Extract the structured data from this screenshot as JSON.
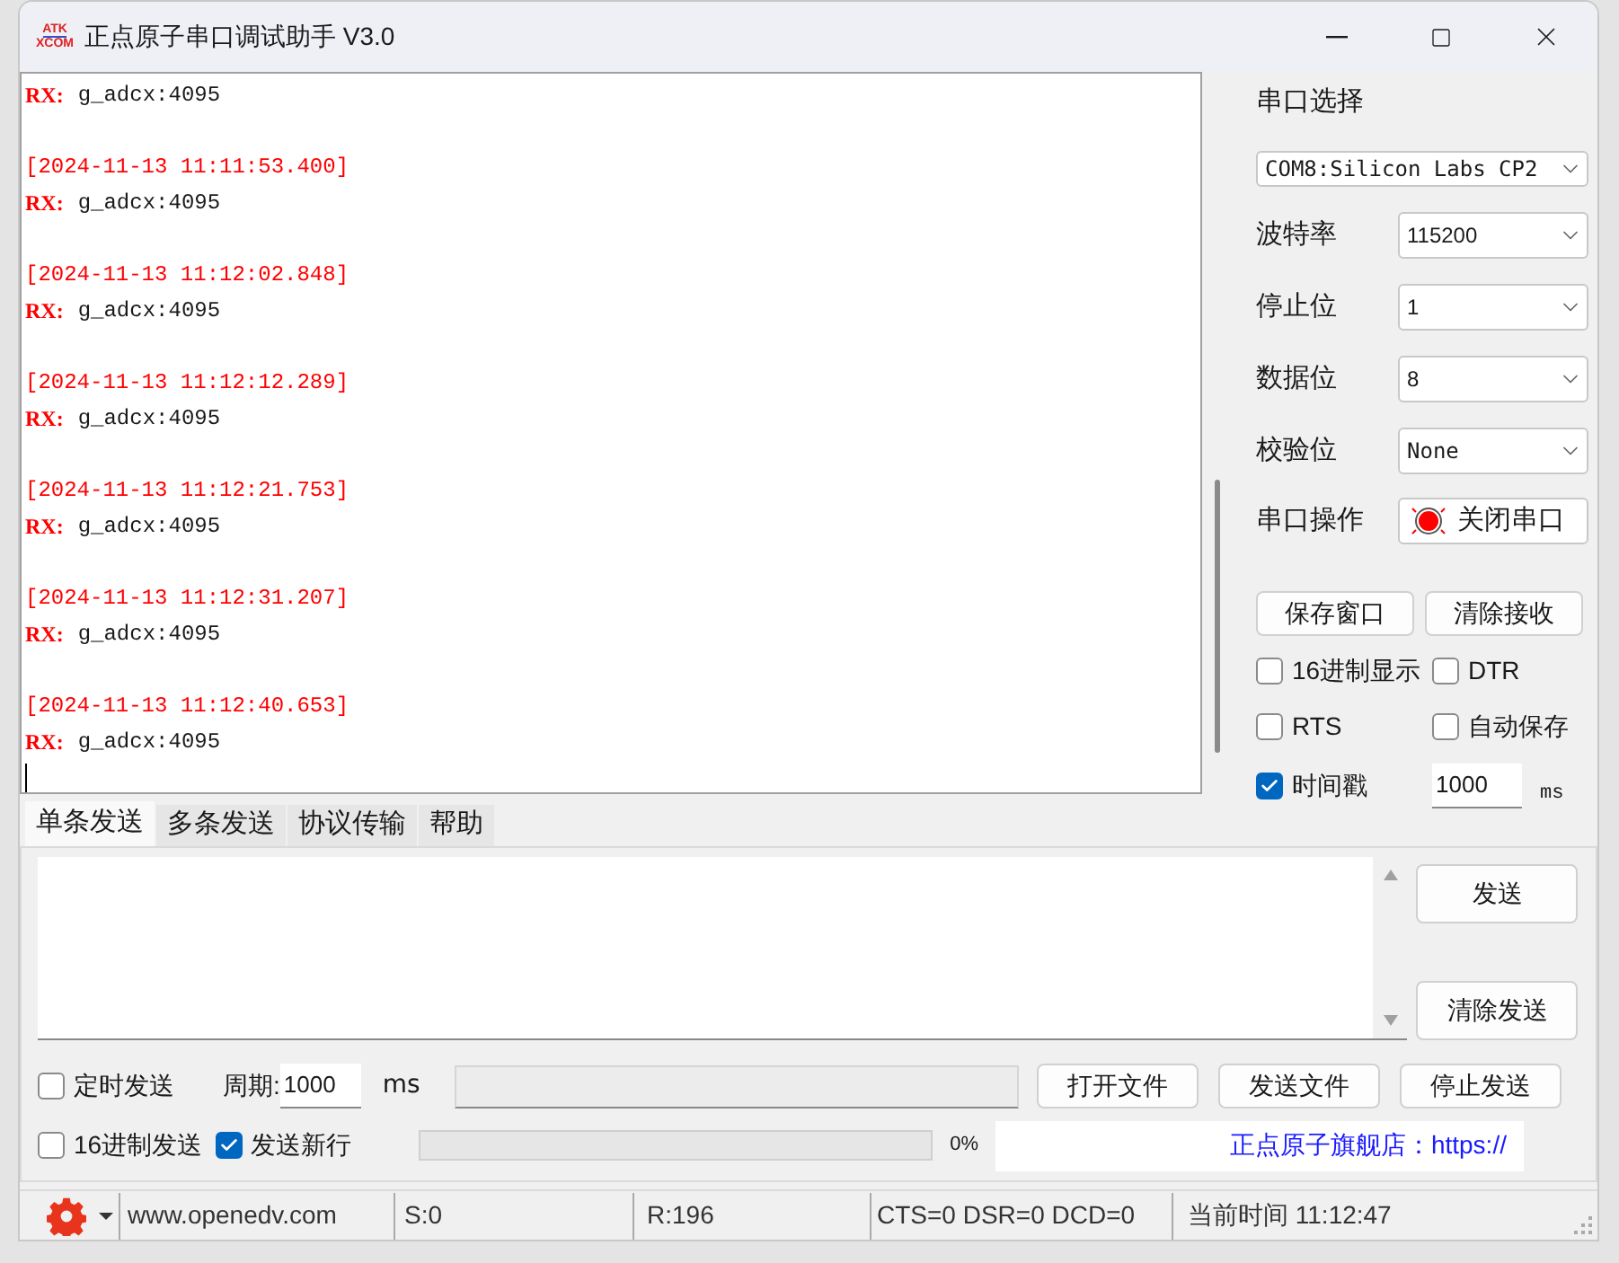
{
  "window": {
    "title": "正点原子串口调试助手 V3.0",
    "logo_top": "ATK",
    "logo_bottom": "XCOM"
  },
  "receive_log": [
    {
      "rx_label": "RX:",
      "data": "g_adcx:4095"
    },
    {
      "timestamp": "[2024-11-13 11:11:53.400]",
      "rx_label": "RX:",
      "data": "g_adcx:4095"
    },
    {
      "timestamp": "[2024-11-13 11:12:02.848]",
      "rx_label": "RX:",
      "data": "g_adcx:4095"
    },
    {
      "timestamp": "[2024-11-13 11:12:12.289]",
      "rx_label": "RX:",
      "data": "g_adcx:4095"
    },
    {
      "timestamp": "[2024-11-13 11:12:21.753]",
      "rx_label": "RX:",
      "data": "g_adcx:4095"
    },
    {
      "timestamp": "[2024-11-13 11:12:31.207]",
      "rx_label": "RX:",
      "data": "g_adcx:4095"
    },
    {
      "timestamp": "[2024-11-13 11:12:40.653]",
      "rx_label": "RX:",
      "data": "g_adcx:4095"
    }
  ],
  "serial": {
    "port_label": "串口选择",
    "port": "COM8:Silicon Labs CP2",
    "fields": [
      {
        "label": "波特率",
        "value": "115200"
      },
      {
        "label": "停止位",
        "value": "1"
      },
      {
        "label": "数据位",
        "value": "8"
      },
      {
        "label": "校验位",
        "value": "None"
      }
    ],
    "operation_label": "串口操作",
    "port_button": "关闭串口",
    "port_open": true
  },
  "receive_buttons": [
    "保存窗口",
    "清除接收"
  ],
  "receive_options": [
    {
      "label": "16进制显示",
      "checked": false
    },
    {
      "label": "DTR",
      "checked": false
    },
    {
      "label": "RTS",
      "checked": false
    },
    {
      "label": "自动保存",
      "checked": false
    },
    {
      "label": "时间戳",
      "checked": true
    }
  ],
  "timestamp_interval": {
    "value": "1000",
    "unit": "ms"
  },
  "send_tabs": [
    {
      "label": "单条发送",
      "selected": true
    },
    {
      "label": "多条发送",
      "selected": false
    },
    {
      "label": "协议传输",
      "selected": false
    },
    {
      "label": "帮助",
      "selected": false
    }
  ],
  "send_buttons": [
    "发送",
    "清除发送"
  ],
  "timed_send": {
    "label": "定时发送",
    "checked": false
  },
  "period": {
    "label": "周期:",
    "value": "1000",
    "unit": "ms"
  },
  "file_buttons": [
    "打开文件",
    "发送文件",
    "停止发送"
  ],
  "send_options": [
    {
      "label": "16进制发送",
      "checked": false
    },
    {
      "label": "发送新行",
      "checked": true
    }
  ],
  "progress": {
    "level": 0,
    "reading": "0%"
  },
  "store_link": "正点原子旗舰店：https://",
  "status_bar": {
    "site": "www.openedv.com",
    "sent": "S:0",
    "received": "R:196",
    "lines": "CTS=0 DSR=0 DCD=0",
    "time": "当前时间 11:12:47"
  }
}
